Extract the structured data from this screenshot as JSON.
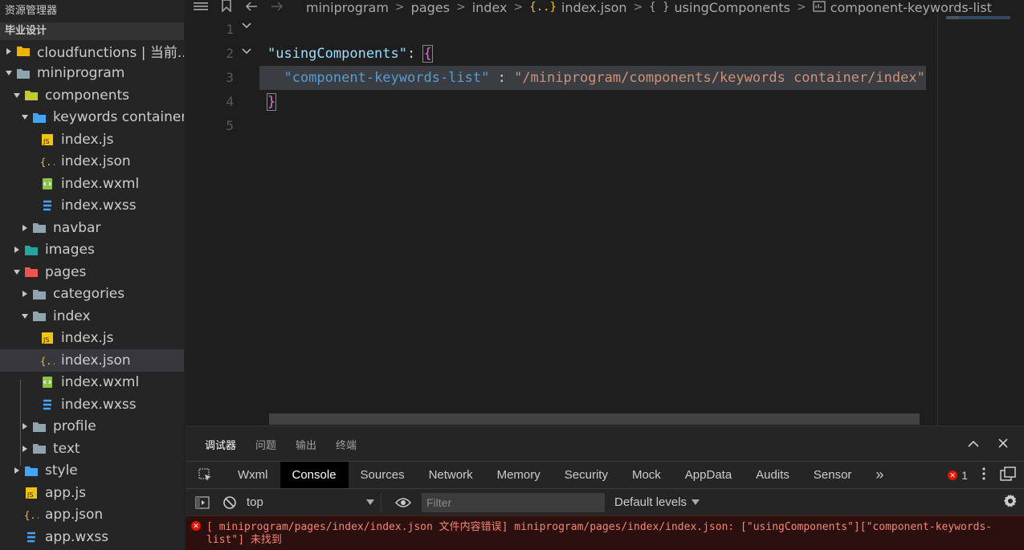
{
  "sidebar": {
    "title": "资源管理器",
    "project": "毕业设计",
    "items": [
      {
        "label": "cloudfunctions | 当前...",
        "depth": 0,
        "expand": "right",
        "icon": "folder-cloud-icon",
        "color": "#f0b400"
      },
      {
        "label": "miniprogram",
        "depth": 0,
        "expand": "down",
        "icon": "folder-open-icon",
        "color": "#90a4ae"
      },
      {
        "label": "components",
        "depth": 1,
        "expand": "down",
        "icon": "folder-components-icon",
        "color": "#c0ca33"
      },
      {
        "label": "keywords container",
        "depth": 2,
        "expand": "down",
        "icon": "folder-open-blue-icon",
        "color": "#42a5f5"
      },
      {
        "label": "index.js",
        "depth": 3,
        "expand": "none",
        "icon": "js-file-icon",
        "color": "#f1c40f"
      },
      {
        "label": "index.json",
        "depth": 3,
        "expand": "none",
        "icon": "json-file-icon",
        "color": "#f1c40f"
      },
      {
        "label": "index.wxml",
        "depth": 3,
        "expand": "none",
        "icon": "wxml-file-icon",
        "color": "#8bc34a"
      },
      {
        "label": "index.wxss",
        "depth": 3,
        "expand": "none",
        "icon": "wxss-file-icon",
        "color": "#42a5f5"
      },
      {
        "label": "navbar",
        "depth": 2,
        "expand": "right",
        "icon": "folder-icon",
        "color": "#90a4ae"
      },
      {
        "label": "images",
        "depth": 1,
        "expand": "right",
        "icon": "folder-images-icon",
        "color": "#26a69a"
      },
      {
        "label": "pages",
        "depth": 1,
        "expand": "down",
        "icon": "folder-pages-icon",
        "color": "#ef5350"
      },
      {
        "label": "categories",
        "depth": 2,
        "expand": "right",
        "icon": "folder-icon",
        "color": "#90a4ae"
      },
      {
        "label": "index",
        "depth": 2,
        "expand": "down",
        "icon": "folder-open-icon",
        "color": "#90a4ae"
      },
      {
        "label": "index.js",
        "depth": 3,
        "expand": "none",
        "icon": "js-file-icon",
        "color": "#f1c40f"
      },
      {
        "label": "index.json",
        "depth": 3,
        "expand": "none",
        "icon": "json-file-icon",
        "color": "#f1c40f",
        "selected": true
      },
      {
        "label": "index.wxml",
        "depth": 3,
        "expand": "none",
        "icon": "wxml-file-icon",
        "color": "#8bc34a"
      },
      {
        "label": "index.wxss",
        "depth": 3,
        "expand": "none",
        "icon": "wxss-file-icon",
        "color": "#42a5f5"
      },
      {
        "label": "profile",
        "depth": 2,
        "expand": "right",
        "icon": "folder-icon",
        "color": "#90a4ae"
      },
      {
        "label": "text",
        "depth": 2,
        "expand": "right",
        "icon": "folder-icon",
        "color": "#90a4ae"
      },
      {
        "label": "style",
        "depth": 1,
        "expand": "right",
        "icon": "folder-style-icon",
        "color": "#42a5f5"
      },
      {
        "label": "app.js",
        "depth": 1,
        "expand": "none",
        "icon": "js-file-icon",
        "color": "#f1c40f"
      },
      {
        "label": "app.json",
        "depth": 1,
        "expand": "none",
        "icon": "json-file-icon",
        "color": "#f1c40f"
      },
      {
        "label": "app.wxss",
        "depth": 1,
        "expand": "none",
        "icon": "wxss-file-icon",
        "color": "#42a5f5"
      }
    ]
  },
  "breadcrumb": {
    "items": [
      {
        "label": "miniprogram",
        "icon": ""
      },
      {
        "label": "pages",
        "icon": ""
      },
      {
        "label": "index",
        "icon": ""
      },
      {
        "label": "index.json",
        "icon": "{..}"
      },
      {
        "label": "usingComponents",
        "icon": "{ }"
      },
      {
        "label": "component-keywords-list",
        "icon": "string-icon"
      }
    ]
  },
  "editor": {
    "lines": [
      {
        "num": "1"
      },
      {
        "num": "2",
        "key": "\"usingComponents\"",
        "after": ": ",
        "brace": "{"
      },
      {
        "num": "3",
        "indent": "  ",
        "key": "\"component-keywords-list\"",
        "mid": " : ",
        "value": "\"/miniprogram/components/keywords container/index\""
      },
      {
        "num": "4",
        "close": "}"
      },
      {
        "num": "5"
      }
    ]
  },
  "panel": {
    "tabs": [
      "调试器",
      "问题",
      "输出",
      "终端"
    ],
    "devtools_tabs": [
      "Wxml",
      "Console",
      "Sources",
      "Network",
      "Memory",
      "Security",
      "Mock",
      "AppData",
      "Audits",
      "Sensor"
    ],
    "active_devtools_tab": "Console",
    "more": "»",
    "error_count": "1",
    "context": "top",
    "filter_placeholder": "Filter",
    "levels": "Default levels",
    "error_message": "[ miniprogram/pages/index/index.json 文件内容错误] miniprogram/pages/index/index.json: [\"usingComponents\"][\"component-keywords-list\"] 未找到"
  },
  "colors": {
    "accent_error": "#e51400",
    "string": "#ce9178",
    "key": "#9cdcfe"
  }
}
